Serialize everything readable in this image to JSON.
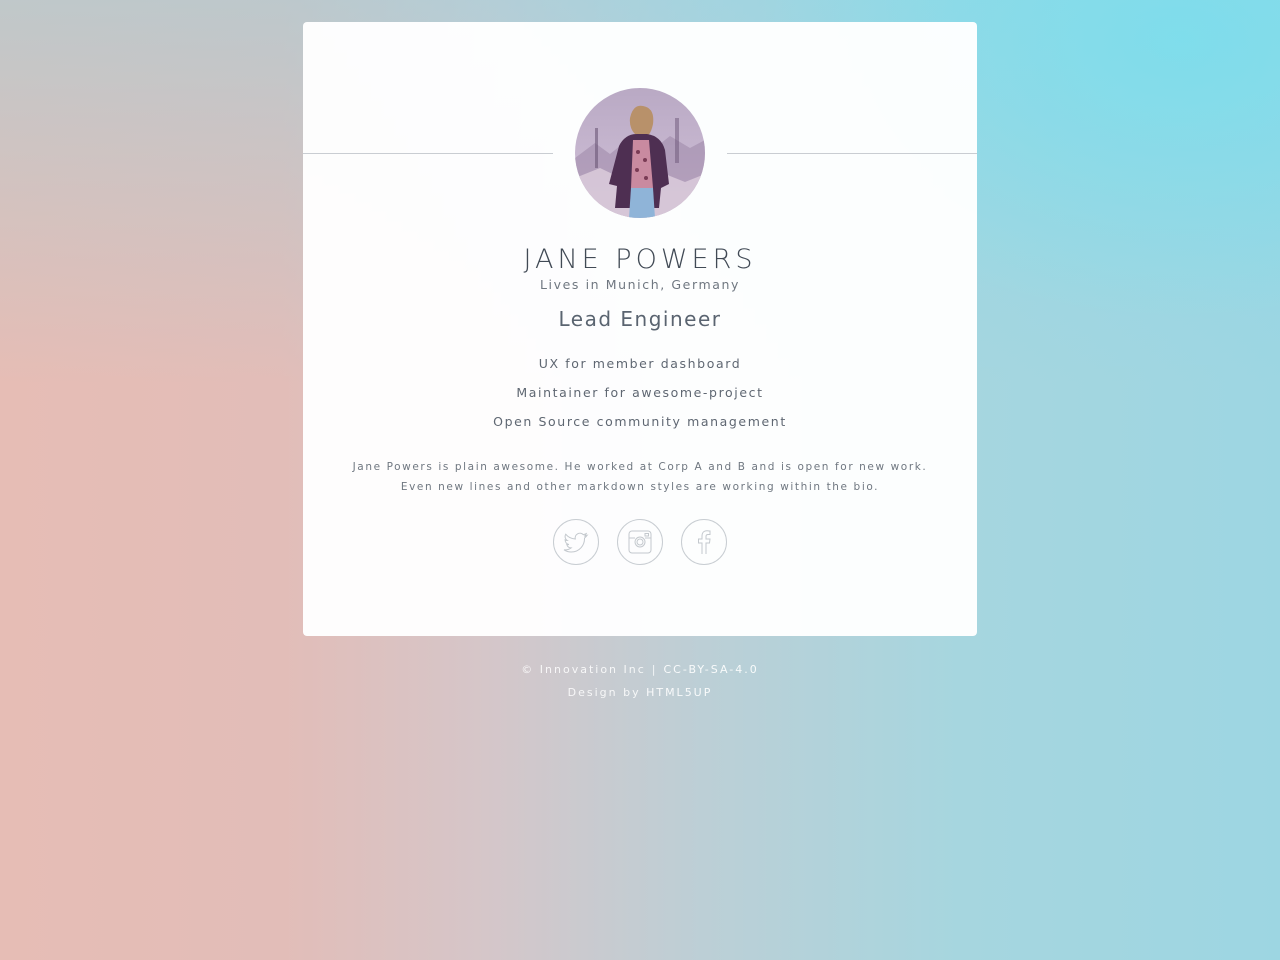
{
  "profile": {
    "name": "JANE POWERS",
    "location": "Lives in Munich, Germany",
    "role": "Lead Engineer",
    "duties": [
      "UX for member dashboard",
      "Maintainer for awesome-project",
      "Open Source community management"
    ],
    "bio_lines": [
      "Jane Powers is plain awesome. He worked at Corp A and B and is open for new work.",
      "Even new lines and other markdown styles are working within the bio."
    ]
  },
  "social": [
    {
      "name": "twitter",
      "icon": "twitter-icon"
    },
    {
      "name": "instagram",
      "icon": "instagram-icon"
    },
    {
      "name": "facebook",
      "icon": "facebook-icon"
    }
  ],
  "footer": {
    "copyright": "© Innovation Inc",
    "license": "CC-BY-SA-4.0",
    "design_prefix": "Design by",
    "design_link": "HTML5UP"
  },
  "colors": {
    "card_bg": "#ffffff",
    "text_dark": "#414a55",
    "bg_left": "#e6bdb5",
    "bg_right": "#9dd6e2"
  }
}
